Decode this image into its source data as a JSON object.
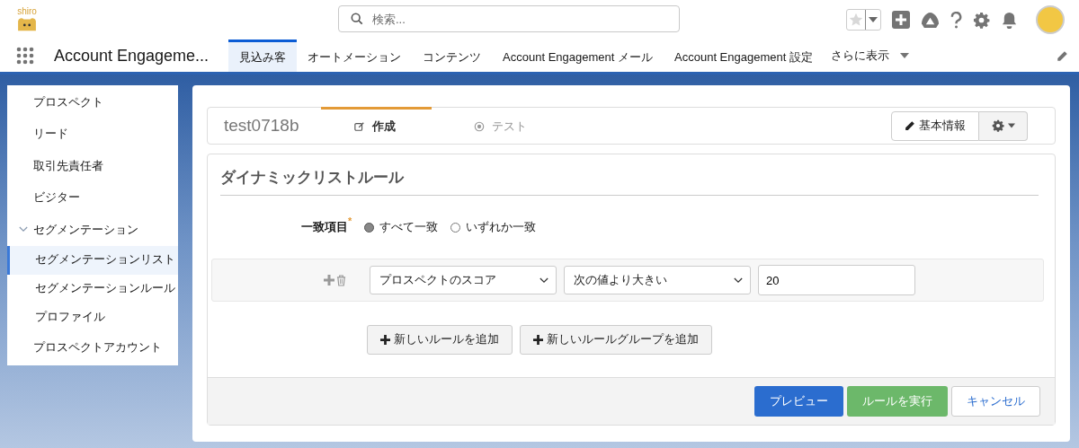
{
  "header": {
    "logo_text": "shiro",
    "search": {
      "placeholder": "検索..."
    }
  },
  "nav": {
    "app_name": "Account Engageme...",
    "tabs": [
      {
        "label": "見込み客",
        "selected": true
      },
      {
        "label": "オートメーション",
        "selected": false
      },
      {
        "label": "コンテンツ",
        "selected": false
      },
      {
        "label": "Account Engagement メール",
        "selected": false
      },
      {
        "label": "Account Engagement 設定",
        "selected": false
      }
    ],
    "more": "さらに表示"
  },
  "sidebar": {
    "items": [
      {
        "label": "プロスペクト",
        "selected": false
      },
      {
        "label": "リード",
        "selected": false
      },
      {
        "label": "取引先責任者",
        "selected": false
      },
      {
        "label": "ビジター",
        "selected": false
      },
      {
        "label": "セグメンテーション",
        "selected": false,
        "expanded": true,
        "children": [
          {
            "label": "セグメンテーションリスト",
            "selected": true
          },
          {
            "label": "セグメンテーションルール",
            "selected": false
          },
          {
            "label": "プロファイル",
            "selected": false
          }
        ]
      },
      {
        "label": "プロスペクトアカウント",
        "selected": false
      }
    ]
  },
  "record": {
    "name": "test0718b",
    "steps": [
      {
        "label": "作成",
        "selected": true
      },
      {
        "label": "テスト",
        "selected": false
      }
    ],
    "edit_button": "基本情報"
  },
  "rules": {
    "title": "ダイナミックリストルール",
    "match_label": "一致項目",
    "required_mark": "*",
    "match_options": [
      {
        "label": "すべて一致",
        "selected": true
      },
      {
        "label": "いずれか一致",
        "selected": false
      }
    ],
    "conditions": [
      {
        "field": "プロスペクトのスコア",
        "operator": "次の値より大きい",
        "value": "20"
      }
    ],
    "add_buttons": [
      "新しいルールを追加",
      "新しいルールグループを追加"
    ]
  },
  "footer_buttons": [
    {
      "label": "プレビュー",
      "kind": "primary"
    },
    {
      "label": "ルールを実行",
      "kind": "success"
    },
    {
      "label": "キャンセル",
      "kind": "neutral"
    }
  ]
}
